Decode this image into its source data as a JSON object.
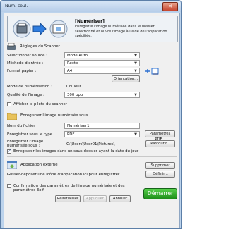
{
  "window": {
    "title": "Num. coul.",
    "close_glyph": "✕"
  },
  "header": {
    "title": "[Numériser]",
    "description": "Enregistre l'image numérisée dans le dossier sélectionné et ouvre l'image à l'aide de l'application spécifiée."
  },
  "scanner": {
    "section_title": "Réglages du Scanner",
    "source_label": "Sélectionner source :",
    "source_value": "Mode Auto",
    "input_method_label": "Méthode d'entrée :",
    "input_method_value": "Recto",
    "paper_format_label": "Format papier :",
    "paper_format_value": "A4",
    "orientation_button": "Orientation...",
    "scan_mode_label": "Mode de numérisation :",
    "scan_mode_value": "Couleur",
    "quality_label": "Qualité de l'image :",
    "quality_value": "300 ppp",
    "show_driver_label": "Afficher le pilote du scanner",
    "show_driver_checked": false
  },
  "save": {
    "section_title": "Enregistrer l'image numérisée sous",
    "filename_label": "Nom du fichier :",
    "filename_value": "Numériser1",
    "type_label": "Enregistrer sous le type :",
    "type_value": "PDF",
    "pdf_settings_button": "Paramètres PDF...",
    "location_label": "Enregistrer l'image numérisée sous :",
    "location_value": "C:\\Users\\User01\\Pictures\\",
    "browse_button": "Parcourir...",
    "subfolder_label": "Enregistrer les images dans un sous-dossier ayant la date du jour",
    "subfolder_checked": true
  },
  "app": {
    "section_title": "Application externe",
    "hint": "Glisser-déposer une icône d'application ici pour enregistrer",
    "delete_button": "Supprimer",
    "define_button": "Définir..."
  },
  "footer": {
    "confirm_label": "Confirmation des paramètres de l'image numérisée et des paramètres Exif",
    "confirm_checked": false,
    "reset_button": "Réinitialiser",
    "apply_button": "Appliquer",
    "cancel_button": "Annuler",
    "start_button": "Démarrer"
  },
  "colors": {
    "start": "#2ea52a",
    "window_frame": "#bcd3ec"
  }
}
